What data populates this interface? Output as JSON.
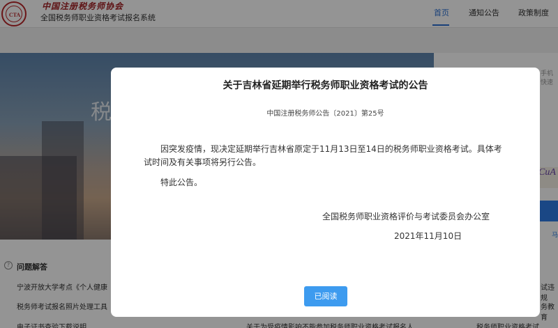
{
  "header": {
    "logo_text": "CTA",
    "brand_calligraphy": "中国注册税务师协会",
    "system_name": "全国税务师职业资格考试报名系统",
    "nav": [
      "首页",
      "通知公告",
      "政策制度"
    ],
    "accent_color": "#2a6fd1"
  },
  "hero": {
    "text_fragment": "税"
  },
  "side_panel": {
    "hint_fragment": "手机快速",
    "captcha_fragment": "CuA",
    "link_fragment": "马"
  },
  "faq": {
    "title": "问题解答",
    "items": [
      "宁波开放大学考点《个人健康",
      "税务师考试报名照片处理工具",
      "电子证书查验下载说明"
    ]
  },
  "lists": {
    "middle_item": "关于为受疫情影响不能参加税务师职业资格考试报名人...",
    "right_item": "税务师职业资格考试...",
    "right_fragment_1": "试违规",
    "right_fragment_2": "务教育"
  },
  "modal": {
    "title": "关于吉林省延期举行税务师职业资格考试的公告",
    "notice_no": "中国注册税务师公告〔2021〕第25号",
    "paragraph1": "因突发疫情，现决定延期举行吉林省原定于11月13日至14日的税务师职业资格考试。具体考试时间及有关事项将另行公告。",
    "paragraph2": "特此公告。",
    "signature": "全国税务师职业资格评价与考试委员会办公室",
    "date": "2021年11月10日",
    "button": "已阅读",
    "button_color": "#3d9bef"
  }
}
